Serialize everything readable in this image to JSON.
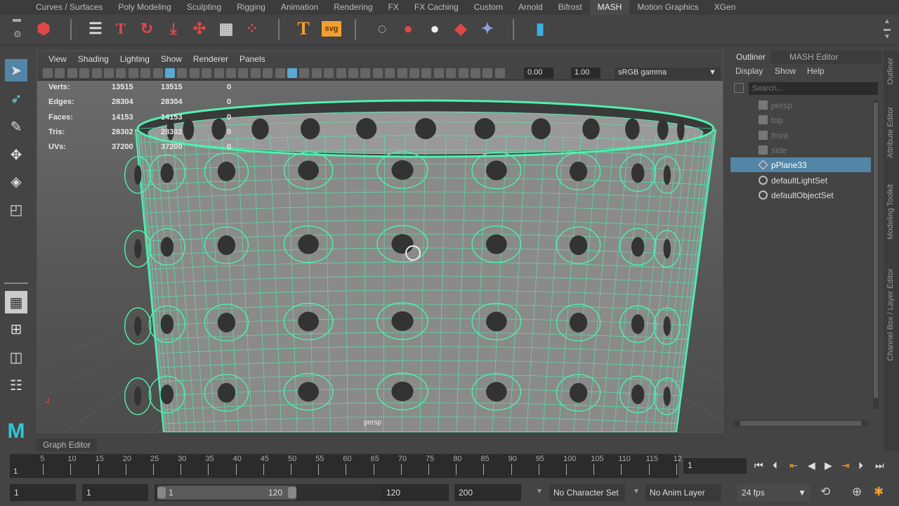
{
  "shelf_tabs": [
    "Curves / Surfaces",
    "Poly Modeling",
    "Sculpting",
    "Rigging",
    "Animation",
    "Rendering",
    "FX",
    "FX Caching",
    "Custom",
    "Arnold",
    "Bifrost",
    "MASH",
    "Motion Graphics",
    "XGen"
  ],
  "active_tab": "MASH",
  "shelf_text_icon": "T",
  "shelf_svg_icon": "svg",
  "viewport": {
    "menu": [
      "View",
      "Shading",
      "Lighting",
      "Show",
      "Renderer",
      "Panels"
    ],
    "exposure": "0.00",
    "gamma": "1.00",
    "colorspace": "sRGB gamma",
    "camera_label": "persp",
    "hud": [
      {
        "label": "Verts:",
        "a": "13515",
        "b": "13515",
        "c": "0"
      },
      {
        "label": "Edges:",
        "a": "28304",
        "b": "28304",
        "c": "0"
      },
      {
        "label": "Faces:",
        "a": "14153",
        "b": "14153",
        "c": "0"
      },
      {
        "label": "Tris:",
        "a": "28302",
        "b": "28302",
        "c": "0"
      },
      {
        "label": "UVs:",
        "a": "37200",
        "b": "37200",
        "c": "0"
      }
    ]
  },
  "outliner": {
    "tabs": [
      "Outliner",
      "MASH Editor"
    ],
    "menu": [
      "Display",
      "Show",
      "Help"
    ],
    "search_placeholder": "Search...",
    "items": [
      {
        "label": "persp",
        "type": "camera",
        "state": "dim"
      },
      {
        "label": "top",
        "type": "camera",
        "state": "dim"
      },
      {
        "label": "front",
        "type": "camera",
        "state": "dim"
      },
      {
        "label": "side",
        "type": "camera",
        "state": "dim"
      },
      {
        "label": "pPlane33",
        "type": "mesh",
        "state": "selected"
      },
      {
        "label": "defaultLightSet",
        "type": "set",
        "state": "normal"
      },
      {
        "label": "defaultObjectSet",
        "type": "set",
        "state": "normal"
      }
    ]
  },
  "right_tabs": [
    "Outliner",
    "Attribute Editor",
    "Modeling Toolkit",
    "Channel Box / Layer Editor"
  ],
  "graph_editor_tab": "Graph Editor",
  "timeline": {
    "ticks": [
      "5",
      "10",
      "15",
      "20",
      "25",
      "30",
      "35",
      "40",
      "45",
      "50",
      "55",
      "60",
      "65",
      "70",
      "75",
      "80",
      "85",
      "90",
      "95",
      "100",
      "105",
      "110",
      "115",
      "12"
    ],
    "current_frame_marker": "1",
    "current_frame": "1"
  },
  "range": {
    "start": "1",
    "playback_start": "1",
    "slider_start": "1",
    "slider_end": "120",
    "playback_end": "120",
    "end": "200",
    "character_set": "No Character Set",
    "anim_layer": "No Anim Layer",
    "fps": "24 fps"
  },
  "colors": {
    "wire": "#4ff0b0",
    "accent": "#5285a6",
    "maya_logo": "#2ec8d8"
  }
}
